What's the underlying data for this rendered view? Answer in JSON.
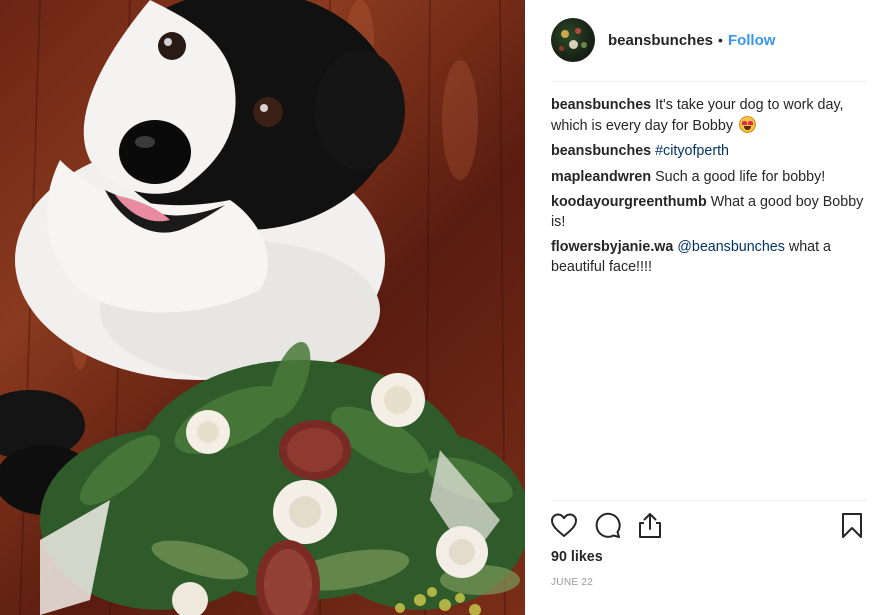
{
  "post": {
    "photo_description_icon": "dog-with-flowers-photo"
  },
  "header": {
    "username": "beansbunches",
    "separator": "•",
    "follow_label": "Follow"
  },
  "comments": [
    {
      "user": "beansbunches",
      "text": "It's take your dog to work day, which is every day for Bobby",
      "emoji": "heart-eyes-emoji"
    },
    {
      "user": "beansbunches",
      "hashtag": "#cityofperth"
    },
    {
      "user": "mapleandwren",
      "text": "Such a good life for bobby!"
    },
    {
      "user": "koodayourgreenthumb",
      "text": "What a good boy Bobby is!"
    },
    {
      "user": "flowersbyjanie.wa",
      "mention": "@beansbunches",
      "text": "what a beautiful face!!!!"
    }
  ],
  "actions": {
    "like_icon": "heart-icon",
    "comment_icon": "comment-icon",
    "share_icon": "share-icon",
    "save_icon": "bookmark-icon"
  },
  "likes": "90 likes",
  "date": "JUNE 22",
  "colors": {
    "follow": "#3897f0",
    "link": "#003569",
    "text": "#262626",
    "muted": "#999999",
    "divider": "#efefef"
  }
}
